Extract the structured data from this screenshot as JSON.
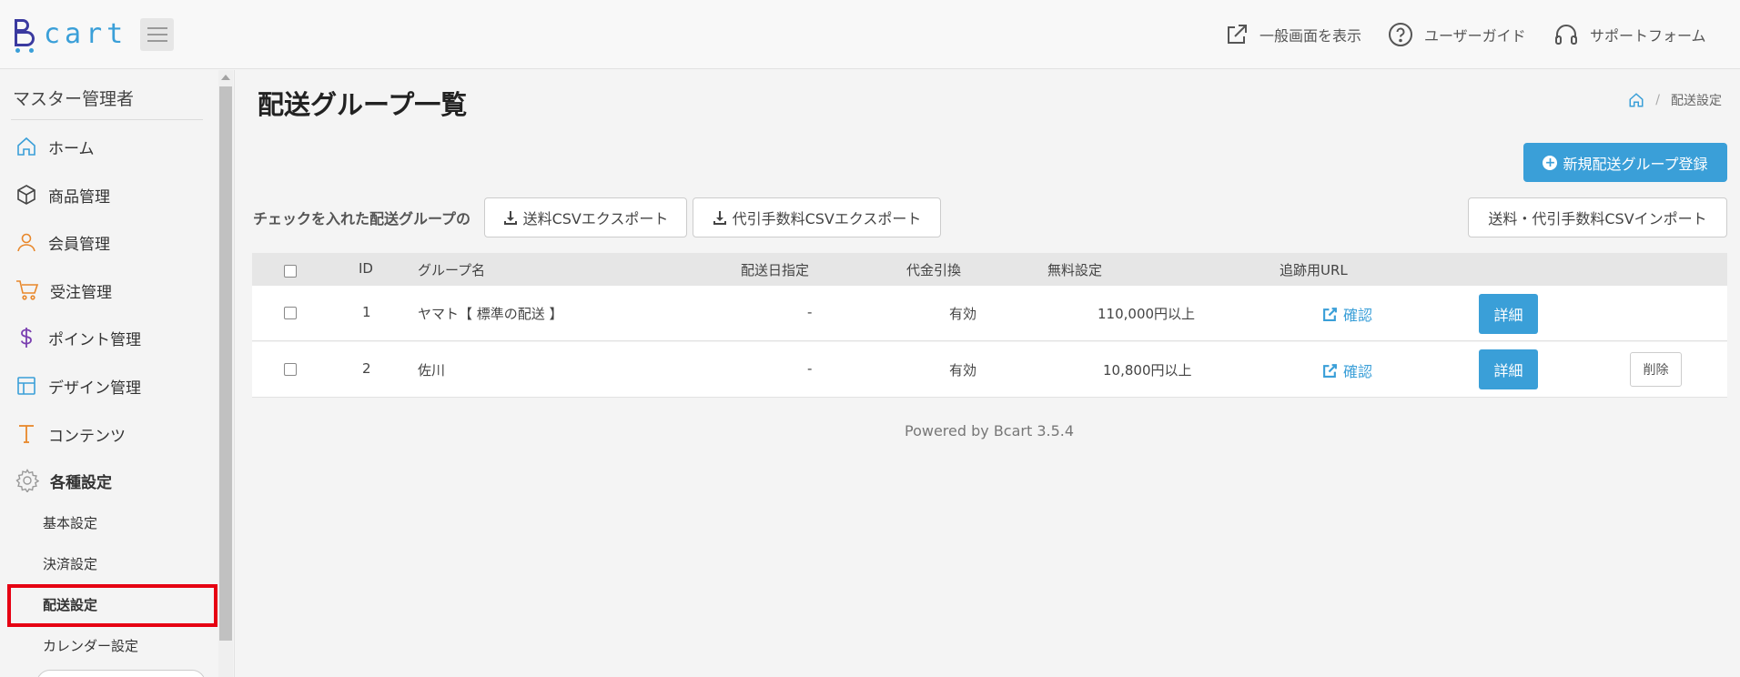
{
  "app": {
    "logo_text": "cart",
    "logo_initial": "B"
  },
  "header": {
    "links": [
      {
        "label": "一般画面を表示",
        "icon": "external-link-icon"
      },
      {
        "label": "ユーザーガイド",
        "icon": "question-circle-icon"
      },
      {
        "label": "サポートフォーム",
        "icon": "headset-icon"
      }
    ]
  },
  "sidebar": {
    "title": "マスター管理者",
    "items": [
      {
        "label": "ホーム",
        "icon": "home-icon"
      },
      {
        "label": "商品管理",
        "icon": "box-icon"
      },
      {
        "label": "会員管理",
        "icon": "user-icon"
      },
      {
        "label": "受注管理",
        "icon": "cart-icon"
      },
      {
        "label": "ポイント管理",
        "icon": "dollar-icon"
      },
      {
        "label": "デザイン管理",
        "icon": "layout-icon"
      },
      {
        "label": "コンテンツ",
        "icon": "text-icon"
      },
      {
        "label": "各種設定",
        "icon": "gear-icon"
      }
    ],
    "subitems": [
      {
        "label": "基本設定"
      },
      {
        "label": "決済設定"
      },
      {
        "label": "配送設定",
        "active": true
      },
      {
        "label": "カレンダー設定"
      }
    ]
  },
  "page": {
    "title": "配送グループ一覧",
    "breadcrumb_current": "配送設定",
    "new_button": "新規配送グループ登録",
    "bulk_label": "チェックを入れた配送グループの",
    "export_shipping": "送料CSVエクスポート",
    "export_cod": "代引手数料CSVエクスポート",
    "import_button": "送料・代引手数料CSVインポート"
  },
  "table": {
    "columns": [
      "ID",
      "グループ名",
      "配送日指定",
      "代金引換",
      "無料設定",
      "追跡用URL"
    ],
    "rows": [
      {
        "id": "1",
        "name": "ヤマト【 標準の配送 】",
        "delivery_date": "-",
        "cod": "有効",
        "free": "110,000円以上",
        "tracking": "確認",
        "detail": "詳細"
      },
      {
        "id": "2",
        "name": "佐川",
        "delivery_date": "-",
        "cod": "有効",
        "free": "10,800円以上",
        "tracking": "確認",
        "detail": "詳細",
        "delete": "削除"
      }
    ]
  },
  "footer": {
    "text": "Powered by Bcart 3.5.4"
  },
  "colors": {
    "accent": "#3a9fd8",
    "brand": "#3b3aa0",
    "highlight": "#e60012"
  }
}
